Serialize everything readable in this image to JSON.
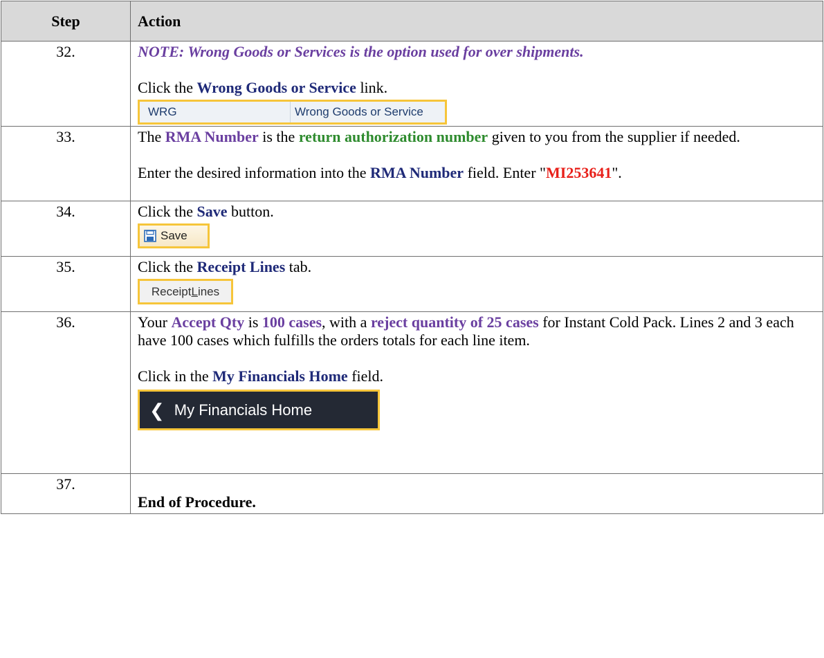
{
  "header": {
    "step": "Step",
    "action": "Action"
  },
  "rows": [
    {
      "step": "32.",
      "note": "NOTE: Wrong Goods or Services is the option used for over shipments.",
      "line1_prefix": "Click the ",
      "line1_bold": "Wrong Goods or Service",
      "line1_suffix": " link.",
      "image": {
        "col1": "WRG",
        "col2": "Wrong Goods or Service"
      }
    },
    {
      "step": "33.",
      "p1_a": "The ",
      "p1_b": "RMA Number",
      "p1_c": " is the ",
      "p1_d": "return authorization number",
      "p1_e": " given to you from the supplier if needed.",
      "p2_a": "Enter the desired information into the ",
      "p2_b": "RMA Number",
      "p2_c": " field. Enter \"",
      "p2_d": "MI253641",
      "p2_e": "\"."
    },
    {
      "step": "34.",
      "line_prefix": "Click the ",
      "line_bold": "Save",
      "line_suffix": " button.",
      "image_label": "Save"
    },
    {
      "step": "35.",
      "line_prefix": "Click the ",
      "line_bold": "Receipt Lines",
      "line_suffix": " tab.",
      "image_label_pre": "Receipt ",
      "image_label_u": "L",
      "image_label_post": "ines"
    },
    {
      "step": "36.",
      "p1_a": "Your ",
      "p1_b": "Accept Qty",
      "p1_c": " is ",
      "p1_d": "100 cases",
      "p1_e": ", with a ",
      "p1_f": "reject quantity of 25 cases",
      "p1_g": " for Instant Cold Pack. Lines 2 and 3 each have 100 cases which fulfills the orders totals for each line item.",
      "p2_a": "Click in the ",
      "p2_b": "My Financials Home",
      "p2_c": " field.",
      "image_label": "My Financials Home"
    },
    {
      "step": "37.",
      "text": "End of Procedure."
    }
  ]
}
